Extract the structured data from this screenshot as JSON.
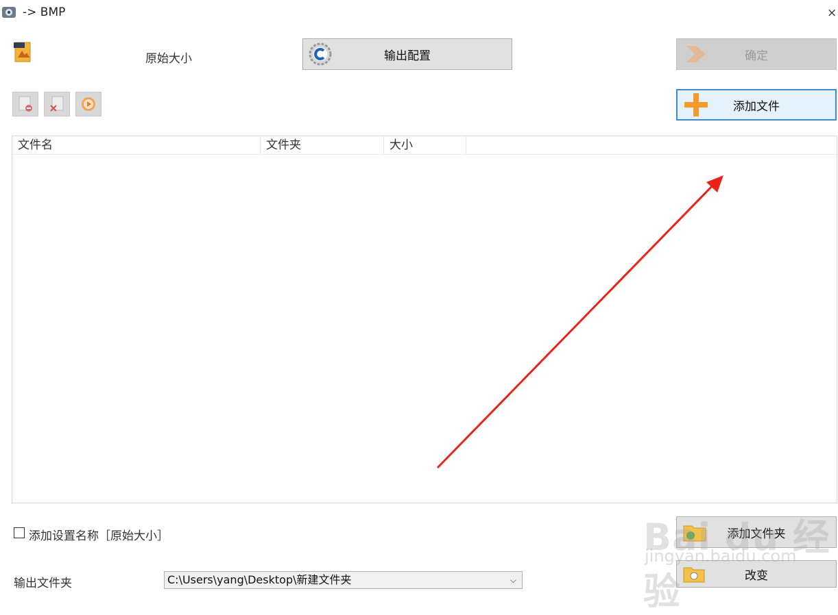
{
  "window": {
    "title": "-> BMP",
    "close_glyph": "×"
  },
  "preset": {
    "label": "原始大小"
  },
  "buttons": {
    "output_config": "输出配置",
    "ok": "确定",
    "add_file": "添加文件",
    "add_folder": "添加文件夹",
    "change": "改变"
  },
  "file_list": {
    "columns": [
      "文件名",
      "文件夹",
      "大小"
    ],
    "rows": []
  },
  "options": {
    "add_setting_name_label": "添加设置名称［原始大小］",
    "add_setting_name_checked": false
  },
  "output_folder": {
    "label": "输出文件夹",
    "path": "C:\\Users\\yang\\Desktop\\新建文件夹"
  },
  "annotation": {
    "arrow_color": "#e8231a"
  },
  "watermark": {
    "main": "Bai du 经验",
    "sub": "jingyan.baidu.com"
  },
  "colors": {
    "accent": "#3c8ad3",
    "orange": "#f39a2b"
  }
}
